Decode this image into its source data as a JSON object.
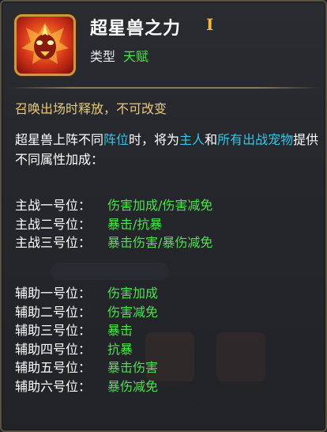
{
  "skill": {
    "title": "超星兽之力",
    "rank": "I",
    "type_label": "类型",
    "type_value": "天赋",
    "icon": "phoenix-skill-icon"
  },
  "rule": "召唤出场时释放，不可改变",
  "description": {
    "p1": "超星兽上阵不同",
    "hl1": "阵位",
    "p2": "时，将为",
    "hl2": "主人",
    "p3": "和",
    "hl3": "所有出战宠物",
    "p4": "提供不同属性加成："
  },
  "main_slots": [
    {
      "label": "主战一号位：",
      "value": "伤害加成/伤害减免"
    },
    {
      "label": "主战二号位：",
      "value": "暴击/抗暴"
    },
    {
      "label": "主战三号位：",
      "value": "暴击伤害/暴伤减免"
    }
  ],
  "aux_slots": [
    {
      "label": "辅助一号位：",
      "value": "伤害加成"
    },
    {
      "label": "辅助二号位：",
      "value": "伤害减免"
    },
    {
      "label": "辅助三号位：",
      "value": "暴击"
    },
    {
      "label": "辅助四号位：",
      "value": "抗暴"
    },
    {
      "label": "辅助五号位：",
      "value": "暴击伤害"
    },
    {
      "label": "辅助六号位：",
      "value": "暴伤减免"
    }
  ],
  "colors": {
    "title": "#ffffff",
    "rank": "#f5b942",
    "type_value": "#4fe04f",
    "rule": "#e8c978",
    "highlight": "#33c6e8",
    "attribute": "#4fe04f"
  }
}
